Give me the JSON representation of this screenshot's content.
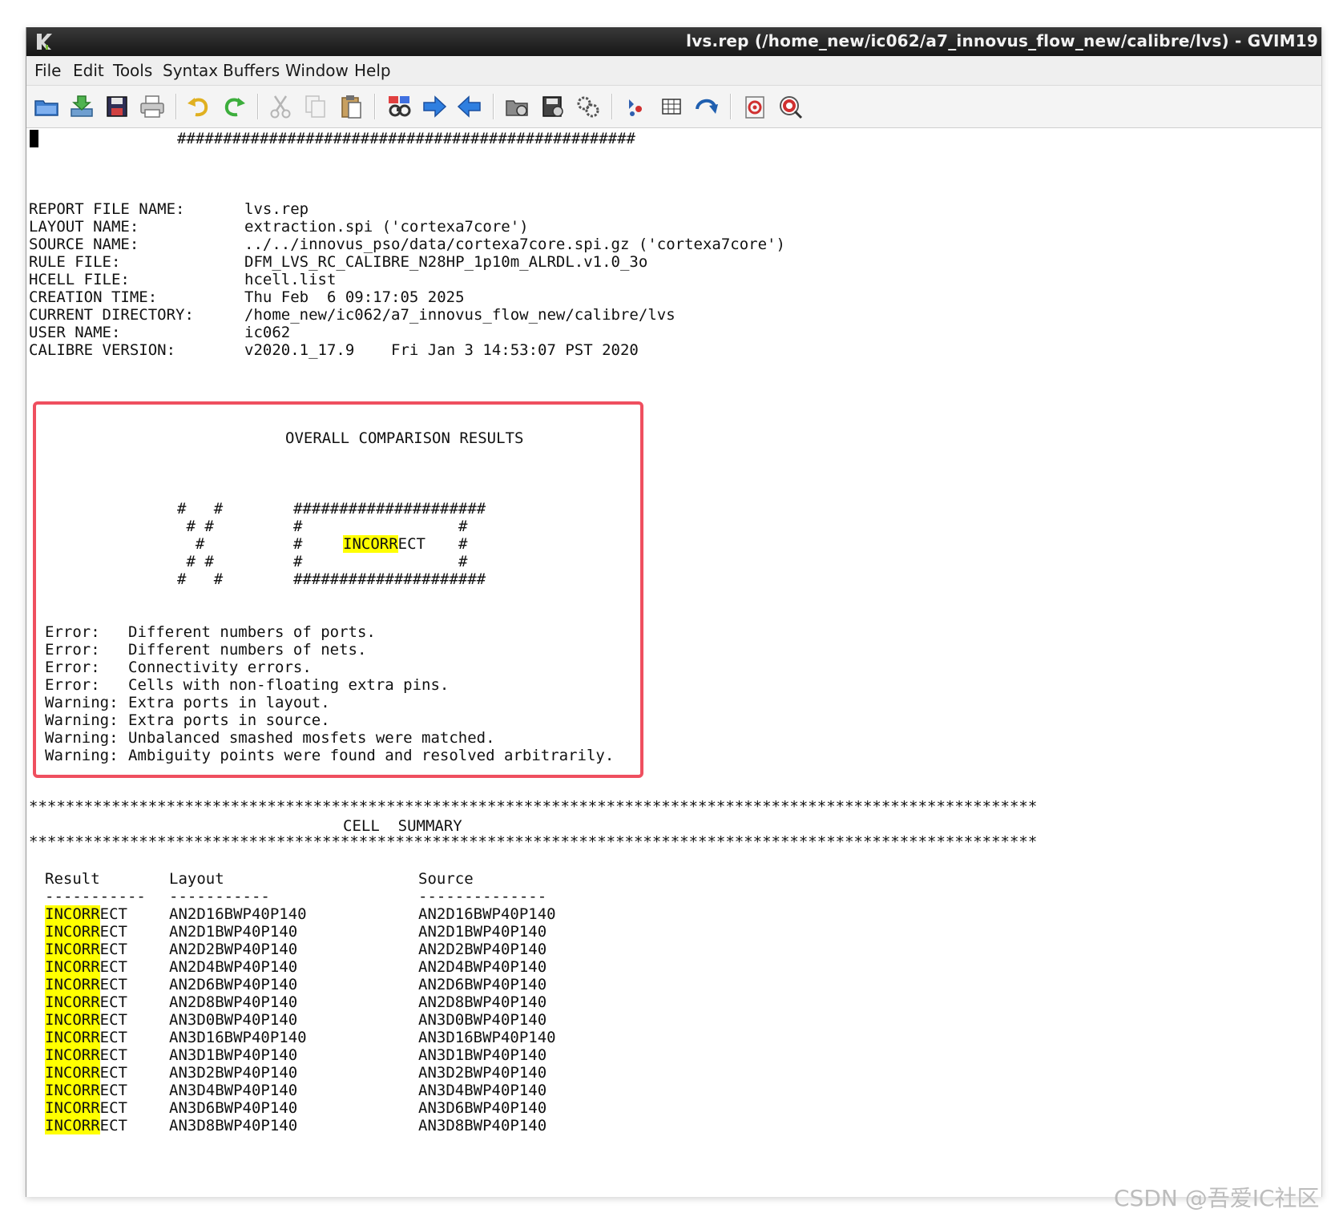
{
  "window": {
    "title": "lvs.rep (/home_new/ic062/a7_innovus_flow_new/calibre/lvs) - GVIM19"
  },
  "menu": [
    "File",
    "Edit",
    "Tools",
    "Syntax",
    "Buffers",
    "Window",
    "Help"
  ],
  "toolbar_icons": [
    "open-icon",
    "save-download-icon",
    "save-icon",
    "print-icon",
    "undo-icon",
    "redo-icon",
    "cut-icon",
    "copy-icon",
    "paste-icon",
    "find-replace-icon",
    "find-next-icon",
    "find-prev-icon",
    "load-session-icon",
    "save-session-icon",
    "run-script-icon",
    "make-icon",
    "table-icon",
    "jump-tag-icon",
    "help-icon",
    "find-help-icon"
  ],
  "report": {
    "banner": "##################################################",
    "header_fields": [
      {
        "label": "REPORT FILE NAME:",
        "value": "lvs.rep"
      },
      {
        "label": "LAYOUT NAME:",
        "value": "extraction.spi ('cortexa7core')"
      },
      {
        "label": "SOURCE NAME:",
        "value": "../../innovus_pso/data/cortexa7core.spi.gz ('cortexa7core')"
      },
      {
        "label": "RULE FILE:",
        "value": "DFM_LVS_RC_CALIBRE_N28HP_1p10m_ALRDL.v1.0_3o"
      },
      {
        "label": "HCELL FILE:",
        "value": "hcell.list"
      },
      {
        "label": "CREATION TIME:",
        "value": "Thu Feb  6 09:17:05 2025"
      },
      {
        "label": "CURRENT DIRECTORY:",
        "value": "/home_new/ic062/a7_innovus_flow_new/calibre/lvs"
      },
      {
        "label": "USER NAME:",
        "value": "ic062"
      },
      {
        "label": "CALIBRE VERSION:",
        "value": "v2020.1_17.9    Fri Jan 3 14:53:07 PST 2020"
      }
    ],
    "overall_title": "OVERALL COMPARISON RESULTS",
    "x_art": [
      "#   #",
      " # #",
      "  #",
      " # #",
      "#   #"
    ],
    "box_border": "#####################",
    "box_side": "#",
    "result_word_hl": "INCORR",
    "result_word_rest": "ECT",
    "messages": [
      {
        "type": "Error:",
        "text": "Different numbers of ports."
      },
      {
        "type": "Error:",
        "text": "Different numbers of nets."
      },
      {
        "type": "Error:",
        "text": "Connectivity errors."
      },
      {
        "type": "Error:",
        "text": "Cells with non-floating extra pins."
      },
      {
        "type": "Warning:",
        "text": "Extra ports in layout."
      },
      {
        "type": "Warning:",
        "text": "Extra ports in source."
      },
      {
        "type": "Warning:",
        "text": "Unbalanced smashed mosfets were matched."
      },
      {
        "type": "Warning:",
        "text": "Ambiguity points were found and resolved arbitrarily."
      }
    ],
    "stars": "**************************************************************************************************************",
    "cell_summary_title": "CELL  SUMMARY",
    "columns": {
      "result": "Result",
      "layout": "Layout",
      "source": "Source",
      "result_dash": "-----------",
      "layout_dash": "-----------",
      "source_dash": "--------------"
    },
    "rows": [
      {
        "hl": "INCORR",
        "rest": "ECT",
        "layout": "AN2D16BWP40P140",
        "source": "AN2D16BWP40P140"
      },
      {
        "hl": "INCORR",
        "rest": "ECT",
        "layout": "AN2D1BWP40P140",
        "source": "AN2D1BWP40P140"
      },
      {
        "hl": "INCORR",
        "rest": "ECT",
        "layout": "AN2D2BWP40P140",
        "source": "AN2D2BWP40P140"
      },
      {
        "hl": "INCORR",
        "rest": "ECT",
        "layout": "AN2D4BWP40P140",
        "source": "AN2D4BWP40P140"
      },
      {
        "hl": "INCORR",
        "rest": "ECT",
        "layout": "AN2D6BWP40P140",
        "source": "AN2D6BWP40P140"
      },
      {
        "hl": "INCORR",
        "rest": "ECT",
        "layout": "AN2D8BWP40P140",
        "source": "AN2D8BWP40P140"
      },
      {
        "hl": "INCORR",
        "rest": "ECT",
        "layout": "AN3D0BWP40P140",
        "source": "AN3D0BWP40P140"
      },
      {
        "hl": "INCORR",
        "rest": "ECT",
        "layout": "AN3D16BWP40P140",
        "source": "AN3D16BWP40P140"
      },
      {
        "hl": "INCORR",
        "rest": "ECT",
        "layout": "AN3D1BWP40P140",
        "source": "AN3D1BWP40P140"
      },
      {
        "hl": "INCORR",
        "rest": "ECT",
        "layout": "AN3D2BWP40P140",
        "source": "AN3D2BWP40P140"
      },
      {
        "hl": "INCORR",
        "rest": "ECT",
        "layout": "AN3D4BWP40P140",
        "source": "AN3D4BWP40P140"
      },
      {
        "hl": "INCORR",
        "rest": "ECT",
        "layout": "AN3D6BWP40P140",
        "source": "AN3D6BWP40P140"
      },
      {
        "hl": "INCORR",
        "rest": "ECT",
        "layout": "AN3D8BWP40P140",
        "source": "AN3D8BWP40P140"
      }
    ]
  },
  "watermark": "CSDN @吾爱IC社区",
  "colors": {
    "highlight": "#ffff00",
    "annotation_box": "#ef4f5f",
    "titlebar": "#1e1e1e"
  }
}
